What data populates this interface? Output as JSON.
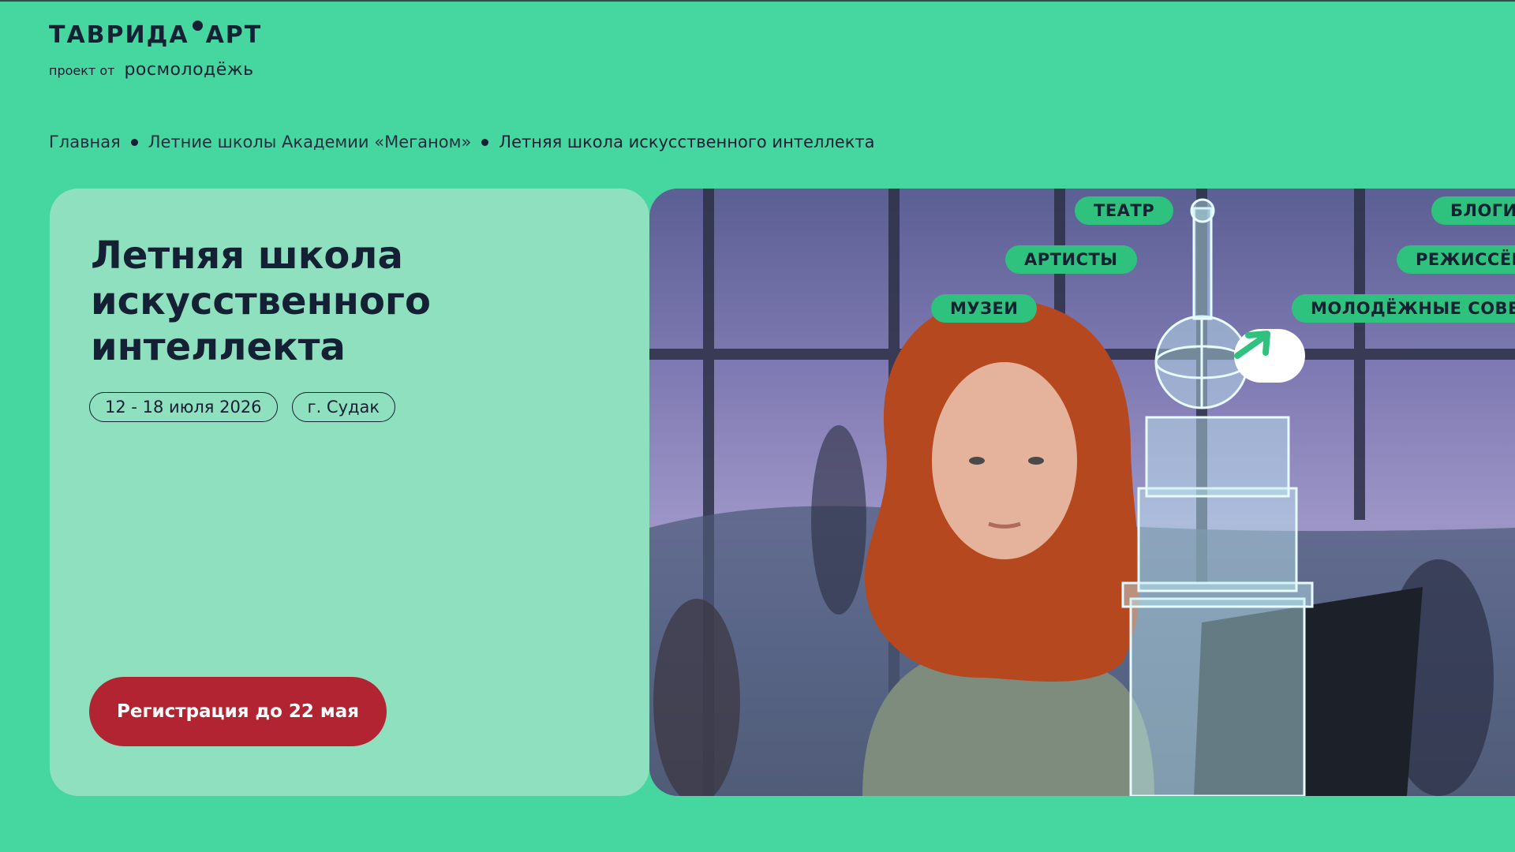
{
  "logo": {
    "name_left": "ТАВРИДА",
    "name_right": "АРТ",
    "subtitle_prefix": "проект от",
    "subtitle_brand": "росмолодёжь"
  },
  "breadcrumb": {
    "items": [
      {
        "label": "Главная"
      },
      {
        "label": "Летние школы Академии «Меганом»"
      },
      {
        "label": "Летняя школа искусственного интеллекта"
      }
    ]
  },
  "card": {
    "title_lines": [
      "Летняя школа",
      "искусственного",
      "интеллекта"
    ],
    "chips": [
      "12 - 18 июля 2026",
      "г. Судак"
    ],
    "register_button": "Регистрация до 22 мая"
  },
  "hero": {
    "tags": [
      "ТЕАТР",
      "БЛОГИ",
      "АРТИСТЫ",
      "РЕЖИССЁР",
      "МУЗЕИ",
      "МОЛОДЁЖНЫЕ СОВЕТ"
    ],
    "accent_color": "#2FC27F",
    "arrow_icon": "arrow-right-icon"
  },
  "colors": {
    "background": "#46D6A0",
    "card": "#8FE0BE",
    "button": "#B32433",
    "text": "#142033"
  }
}
